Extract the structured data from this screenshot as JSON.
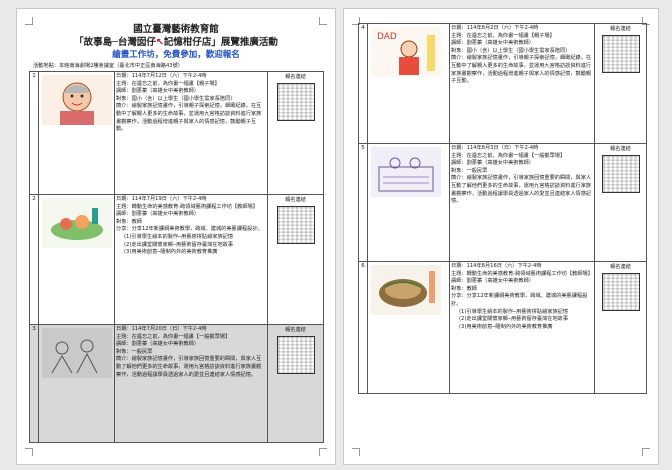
{
  "header": {
    "org": "國立臺灣藝術教育館",
    "exhibition_prefix": "「故事島─台灣囡仔",
    "exhibition_highlight": "↖",
    "exhibition_suffix": "記憶柑仔店」展覽推廣活動",
    "subtitle": "繪畫工作坊，免費參加，歡迎報名",
    "venue": "活動地點：本館南海劇場2樓會議室（臺北市中正區南海路43號）"
  },
  "events": [
    {
      "num": "1",
      "date": "日期：114年7月12日（六）下午2-4時",
      "theme": "主題：在遺忘之前，為你畫一幅畫【親子場】",
      "lecturer": "講師：劉蔥蓁（高雄女中美術教師）",
      "audience": "對象：國小（含）以上學生（國小學生需家長陪同）",
      "intro": "簡介：繪製家族記憶畫作，引導親子探索記憶，細緻紀錄，在互動中了解親人更多的生命故事，並運用九宮格訪談資料進行家族畫觀察作，活動過程增進親子與家人的情感記憶，鼓勵親子互動。",
      "reg": "報名連結"
    },
    {
      "num": "2",
      "date": "日期：114年7月19日（六）下午2-4時",
      "theme": "主題：轉動生命的美感教育-跨領域藝術課程工作坊【教師場】",
      "lecturer": "講師：劉蔥蓁（高雄女中美術教師）",
      "audience": "對象：教師",
      "intro": "分享：分享12年新課綱美術教學，跨域、建城的美藝課程設計。",
      "bullets": [
        "(1)引導學生繪本的製作─用藝術拼貼繪家族記憶",
        "(2)走出課堂關懷家鄉─用藝術留存臺灣在地故事",
        "(3)用美術創意─隨制內外的美術教育推廣"
      ],
      "reg": "報名連結"
    },
    {
      "num": "3",
      "date": "日期：114年7月20日（日）下午2-4時",
      "theme": "主題：在遺忘之前，為你畫一幅畫【一般觀眾場】",
      "lecturer": "講師：劉蔥蓁（高雄女中美術教師）",
      "audience": "對象：一般民眾",
      "intro": "簡介：繪製家族記憶畫作，引導家族回憶重要的瞬間，與家人互動了解他們更多的生命故事，運用九宮格訪談資料進行家族畫觀察作，活動過程讓學員透過家人的愛並且連結家人情感記憶。",
      "reg": "報名連結"
    },
    {
      "num": "4",
      "date": "日期：114年8月2日（六）下午2-4時",
      "theme": "主題：在遺忘之前，為你畫一幅畫【親子場】",
      "lecturer": "講師：劉蔥蓁（高雄女中美術教師）",
      "audience": "對象：國小（含）以上學生（國小學生需家長陪同）",
      "intro": "簡介：繪製家族記憶畫作，引導親子探索記憶，細緻紀錄，在互動中了解親人更多的生命故事，並運用九宮格訪談資料進行家族畫觀察作，活動過程增進親子與家人的情感記憶，鼓勵親子互動。",
      "reg": "報名連結"
    },
    {
      "num": "5",
      "date": "日期：114年8月3日（日）下午2-4時",
      "theme": "主題：在遺忘之前，為你畫一幅畫【一般觀眾場】",
      "lecturer": "講師：劉蔥蓁（高雄女中美術教師）",
      "audience": "對象：一般民眾",
      "intro": "簡介：繪製家族記憶畫作，引導家族回憶重要的瞬間，與家人互動了解他們更多的生命故事，運用九宮格訪談資料進行家族畫觀察作，活動過程讓學員透過家人的愛並且連結家人情感記憶。",
      "reg": "報名連結"
    },
    {
      "num": "6",
      "date": "日期：114年8月16日（六）下午2-4時",
      "theme": "主題：轉動生命的美感教育-跨領域藝術課程工作坊【教師場】",
      "lecturer": "講師：劉蔥蓁（高雄女中美術教師）",
      "audience": "對象：教師",
      "intro": "分享：分享12年新課綱美術教學，跨域、建城的美藝課程設計。",
      "bullets": [
        "(1)引導學生繪本的製作─用藝術拼貼繪家族記憶",
        "(2)走出課堂關懷家鄉─用藝術留存臺灣在地故事",
        "(3)用美術創意─隨制內外的美術教育推廣"
      ],
      "reg": "報名連結"
    }
  ],
  "colors": {
    "highlight_red": "#c00000",
    "subtitle_blue": "#2050c0",
    "shade": "#d8d8d8"
  }
}
